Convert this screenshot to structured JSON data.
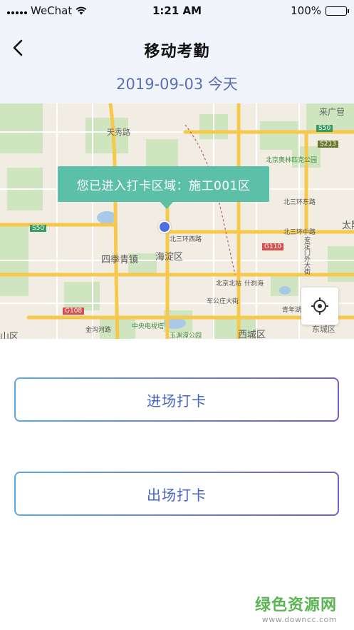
{
  "status_bar": {
    "carrier": "WeChat",
    "time": "1:21 AM",
    "battery": "100%"
  },
  "header": {
    "title": "移动考勤",
    "date": "2019-09-03 今天"
  },
  "map": {
    "tooltip": "您已进入打卡区域：施工001区",
    "labels": {
      "sijiqing": "四季青镇",
      "haidian": "海淀区",
      "xicheng": "西城区",
      "dongcheng": "东城区",
      "shan": "山区",
      "beijing_bei": "北京北站",
      "shichahai": "什刹海",
      "zhongyang": "中央电视塔",
      "yuyuantan": "玉渊潭公园",
      "bei3huan_w": "北三环西路",
      "bei3huan_m": "北三环中路",
      "bei3huan_e": "北三环东路",
      "laiguang": "来广营",
      "beijing_aoti": "北京奥林匹克公园",
      "s50_a": "S50",
      "s50_b": "S50",
      "g110": "G110",
      "g108": "G108",
      "s213": "S213",
      "tianyuan": "天秀路",
      "anding": "安定门外大街",
      "taiyang": "太阳",
      "chegongzhuang": "车公庄大街",
      "jinghe": "金沟河路",
      "qinghe": "青年湖"
    }
  },
  "buttons": {
    "punch_in": "进场打卡",
    "punch_out": "出场打卡"
  },
  "watermark": {
    "text": "绿色资源网",
    "url": "www.downcc.com"
  }
}
